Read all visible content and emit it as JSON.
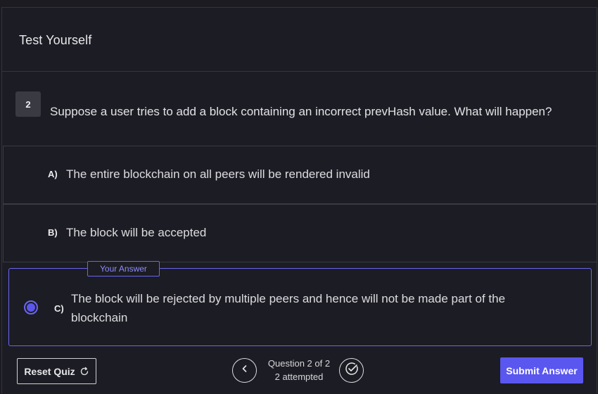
{
  "header": {
    "title": "Test Yourself"
  },
  "question": {
    "number": "2",
    "text": "Suppose a user tries to add a block containing an incorrect prevHash value. What will happen?"
  },
  "options": [
    {
      "letter": "A)",
      "text": "The entire blockchain on all peers will be rendered invalid",
      "selected": false
    },
    {
      "letter": "B)",
      "text": "The block will be accepted",
      "selected": false
    },
    {
      "letter": "C)",
      "text": "The block will be rejected by multiple peers and hence will not be made part of the blockchain",
      "selected": true
    }
  ],
  "selected_tag": "Your Answer",
  "footer": {
    "reset_label": "Reset Quiz",
    "progress_line1": "Question 2 of 2",
    "progress_line2": "2 attempted",
    "submit_label": "Submit Answer"
  },
  "icons": {
    "reset": "refresh-icon",
    "prev": "chevron-left-icon",
    "check": "check-circle-icon"
  },
  "colors": {
    "accent": "#5a56f0",
    "background": "#1c1c24",
    "border": "#3a3a42"
  }
}
